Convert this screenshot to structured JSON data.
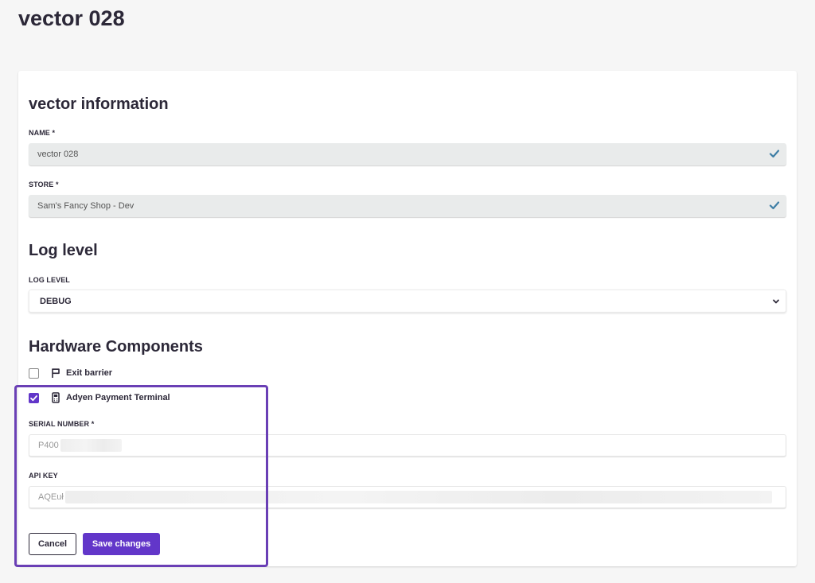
{
  "page": {
    "title": "vector 028"
  },
  "vector_info": {
    "heading": "vector information",
    "name_label": "NAME *",
    "name_value": "vector 028",
    "store_label": "STORE *",
    "store_value": "Sam's Fancy Shop - Dev"
  },
  "log": {
    "heading": "Log level",
    "label": "LOG LEVEL",
    "selected": "DEBUG"
  },
  "hardware": {
    "heading": "Hardware Components",
    "components": [
      {
        "label": "Exit barrier",
        "checked": false,
        "icon": "flag-icon"
      },
      {
        "label": "Adyen Payment Terminal",
        "checked": true,
        "icon": "payment-terminal-icon"
      }
    ],
    "serial_label": "SERIAL NUMBER *",
    "serial_value": "P400",
    "api_label": "API KEY",
    "api_value": "AQEuł"
  },
  "actions": {
    "cancel": "Cancel",
    "save": "Save changes"
  },
  "colors": {
    "accent": "#6236c9",
    "check": "#3f7fa6",
    "highlight": "#6a3fb5"
  }
}
